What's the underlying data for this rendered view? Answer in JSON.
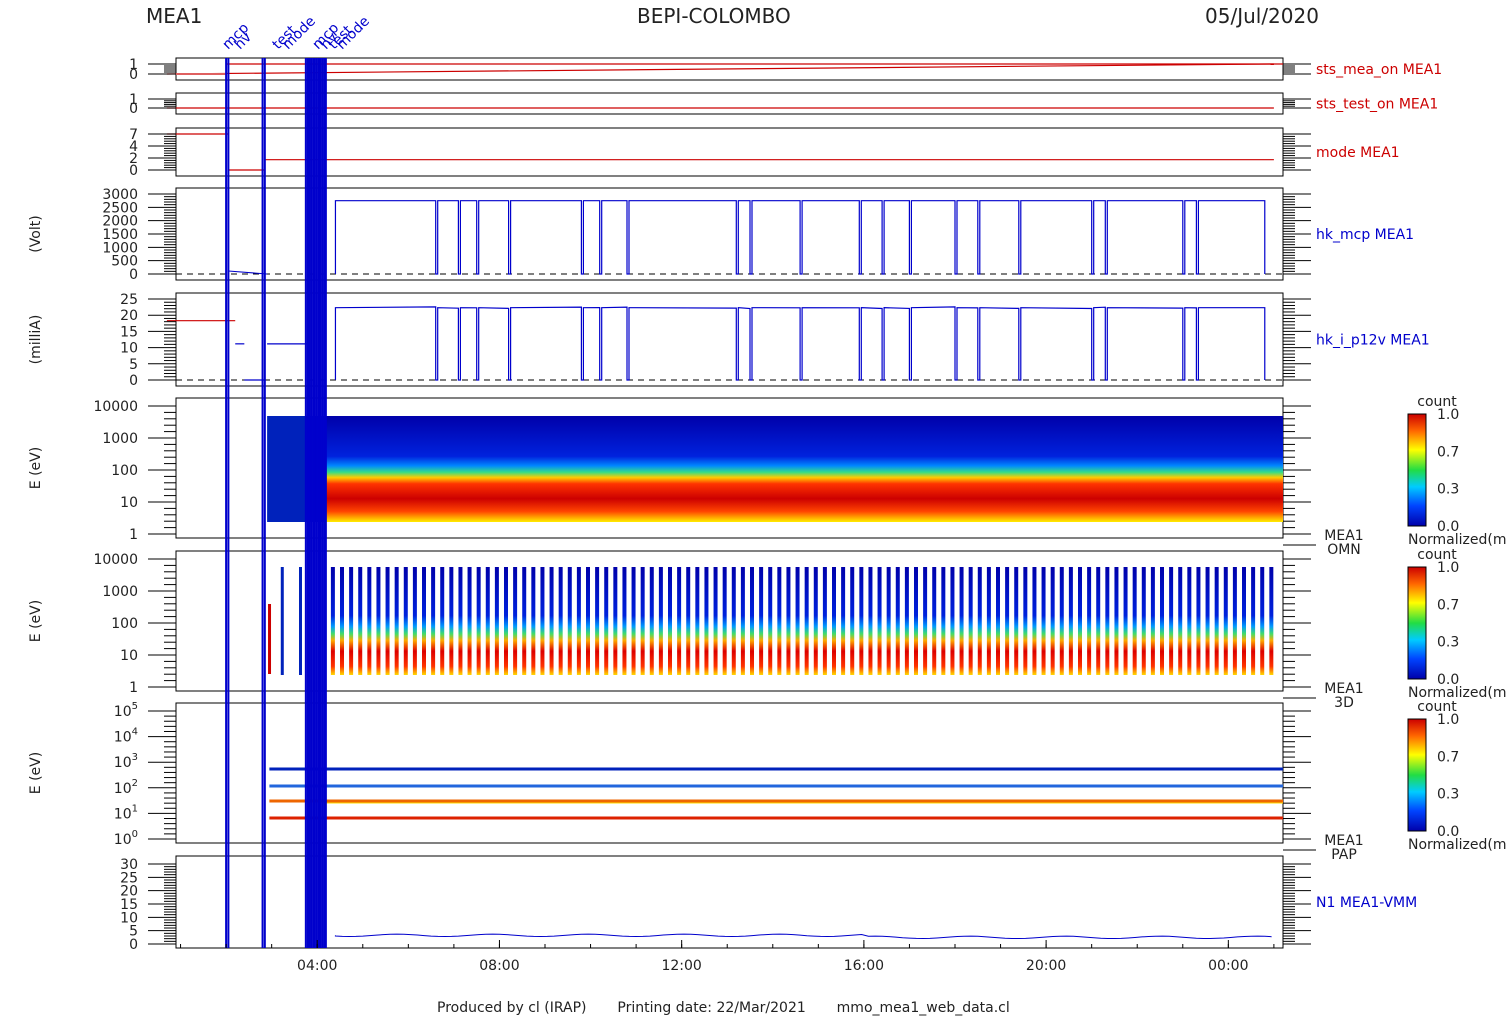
{
  "header": {
    "left": "MEA1",
    "center": "BEPI-COLOMBO",
    "right": "05/Jul/2020"
  },
  "footer": {
    "produced": "Produced by cl (IRAP)",
    "printing": "Printing date: 22/Mar/2021",
    "file": "mmo_mea1_web_data.cl"
  },
  "colors": {
    "red": "#cc0000",
    "blue": "#0000cc",
    "axis": "#000000"
  },
  "annotations": [
    "mcp",
    "hv",
    "test",
    "mode"
  ],
  "time_axis": {
    "ticks": [
      "04:00",
      "08:00",
      "12:00",
      "16:00",
      "20:00",
      "00:00"
    ]
  },
  "chart_data": [
    {
      "type": "line",
      "name": "sts_mea_on MEA1",
      "label": "sts_mea_on MEA1",
      "color": "#cc0000",
      "yticks": [
        "1",
        "0"
      ],
      "ylim": [
        0,
        1
      ],
      "series": [
        {
          "name": "sts_mea_on MEA1",
          "x_hours": [
            0.7,
            25.0
          ],
          "values": [
            0,
            1
          ]
        }
      ]
    },
    {
      "type": "line",
      "name": "sts_test_on MEA1",
      "label": "sts_test_on MEA1",
      "color": "#cc0000",
      "yticks": [
        "1",
        "0"
      ],
      "ylim": [
        0,
        1
      ],
      "series": [
        {
          "name": "sts_test_on MEA1",
          "x_hours": [
            0.7,
            25.0
          ],
          "values": [
            0,
            0
          ]
        }
      ]
    },
    {
      "type": "line",
      "name": "mode MEA1",
      "label": "mode MEA1",
      "color": "#cc0000",
      "yticks": [
        "7",
        "4",
        "2",
        "0"
      ],
      "ylim": [
        0,
        7
      ],
      "series": [
        {
          "name": "mode MEA1",
          "x_hours": [
            0.7,
            2.05,
            2.05,
            2.85,
            2.85,
            25.0
          ],
          "values": [
            7,
            7,
            0,
            0,
            2,
            2
          ]
        }
      ]
    },
    {
      "type": "line",
      "name": "hk_mcp MEA1",
      "label": "hk_mcp MEA1",
      "ylabel": "(Volt)",
      "color": "#0000cc",
      "yticks": [
        "3000",
        "2500",
        "2000",
        "1500",
        "1000",
        "500",
        "0"
      ],
      "ylim": [
        0,
        3000
      ],
      "level": 2750,
      "on_start": 4.4,
      "dips": [
        6.6,
        7.1,
        7.5,
        8.2,
        9.8,
        10.2,
        10.8,
        13.2,
        13.5,
        14.6,
        15.9,
        16.4,
        17.0,
        18.0,
        18.5,
        19.4,
        21.0,
        21.3,
        23.0,
        23.3
      ]
    },
    {
      "type": "line",
      "name": "hk_i_p12v MEA1",
      "label": "hk_i_p12v MEA1",
      "ylabel": "(milliA)",
      "color": "#0000cc",
      "yticks": [
        "25",
        "20",
        "15",
        "10",
        "5",
        "0"
      ],
      "ylim": [
        0,
        28
      ],
      "segments": [
        [
          0.7,
          2.2,
          20.5
        ],
        [
          2.2,
          2.4,
          12.5
        ],
        [
          2.4,
          2.85,
          0
        ],
        [
          2.9,
          3.8,
          12.5
        ]
      ],
      "level": 25,
      "on_start": 4.4
    },
    {
      "type": "heatmap",
      "name": "MEA1 OMN",
      "label": [
        "MEA1",
        "OMN"
      ],
      "ylabel": "E (eV)",
      "yticks": [
        "10000",
        "1000",
        "100",
        "10",
        "1"
      ],
      "ylim": [
        1,
        10000
      ],
      "log": true,
      "colorbar": {
        "title": "count",
        "ticks": [
          "1.0",
          "0.7",
          "0.3",
          "0.0"
        ],
        "label": "Normalized(m"
      }
    },
    {
      "type": "heatmap",
      "name": "MEA1 3D",
      "label": [
        "MEA1",
        "3D"
      ],
      "ylabel": "E (eV)",
      "yticks": [
        "10000",
        "1000",
        "100",
        "10",
        "1"
      ],
      "ylim": [
        1,
        10000
      ],
      "log": true,
      "colorbar": {
        "title": "count",
        "ticks": [
          "1.0",
          "0.7",
          "0.3",
          "0.0"
        ],
        "label": "Normalized(m"
      }
    },
    {
      "type": "heatmap",
      "name": "MEA1 PAP",
      "label": [
        "MEA1",
        "PAP"
      ],
      "ylabel": "E (eV)",
      "yticks": [
        "10",
        "10",
        "10",
        "10",
        "10",
        "10"
      ],
      "ytick_exp": [
        "5",
        "4",
        "3",
        "2",
        "1",
        "0"
      ],
      "ylim": [
        1,
        100000
      ],
      "log": true,
      "colorbar": {
        "title": "count",
        "ticks": [
          "1.0",
          "0.7",
          "0.3",
          "0.0"
        ],
        "label": "Normalized(m"
      }
    },
    {
      "type": "line",
      "name": "N1 MEA1-VMM",
      "label": "N1 MEA1-VMM",
      "color": "#0000cc",
      "yticks": [
        "30",
        "25",
        "20",
        "15",
        "10",
        "5",
        "0"
      ],
      "ylim": [
        0,
        30
      ],
      "level": 2.5,
      "on_start": 4.4
    }
  ]
}
